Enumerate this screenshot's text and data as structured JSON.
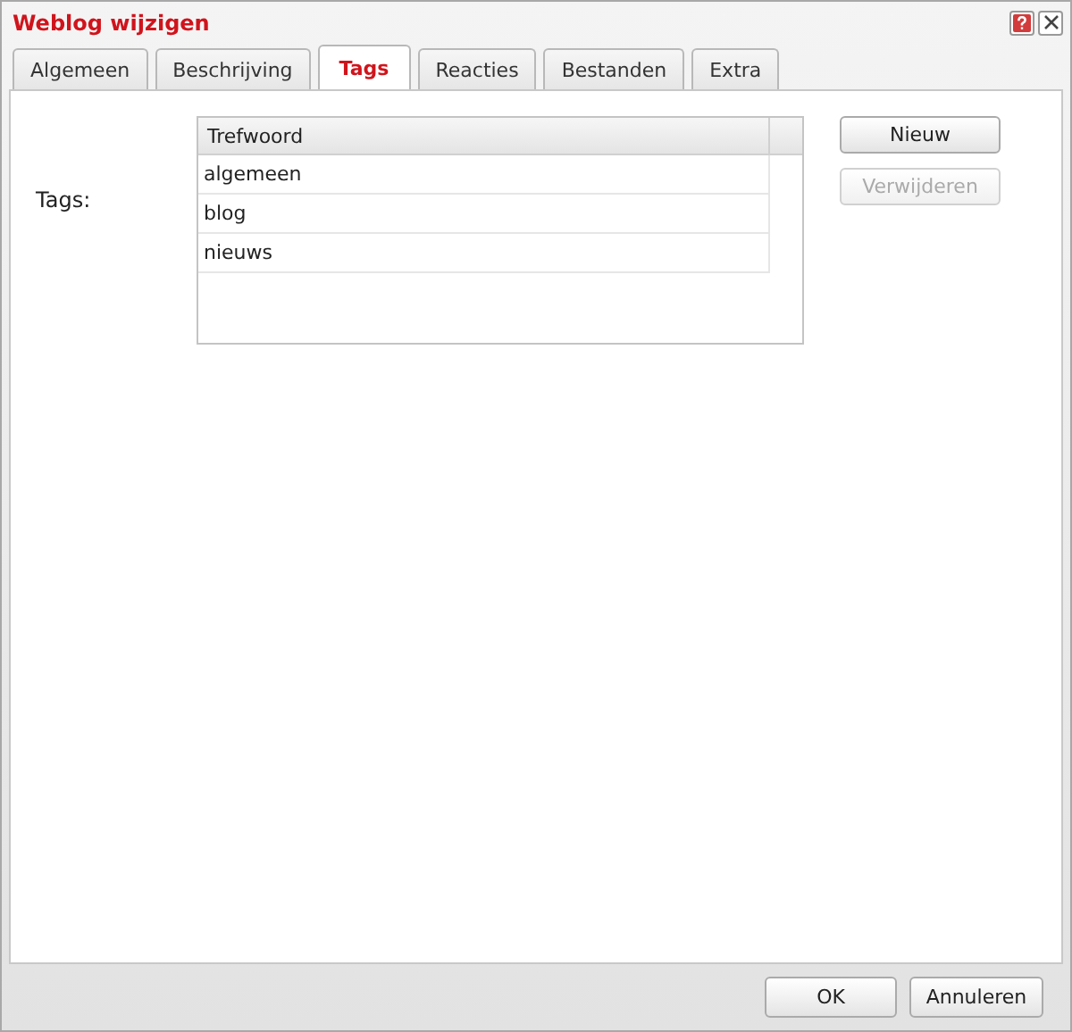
{
  "window": {
    "title": "Weblog wijzigen"
  },
  "tabs": [
    {
      "label": "Algemeen",
      "selected": false
    },
    {
      "label": "Beschrijving",
      "selected": false
    },
    {
      "label": "Tags",
      "selected": true
    },
    {
      "label": "Reacties",
      "selected": false
    },
    {
      "label": "Bestanden",
      "selected": false
    },
    {
      "label": "Extra",
      "selected": false
    }
  ],
  "field_label": "Tags:",
  "table": {
    "columns": [
      "Trefwoord"
    ],
    "rows": [
      [
        "algemeen"
      ],
      [
        "blog"
      ],
      [
        "nieuws"
      ]
    ]
  },
  "side_buttons": [
    {
      "label": "Nieuw",
      "disabled": false
    },
    {
      "label": "Verwijderen",
      "disabled": true
    }
  ],
  "footer_buttons": [
    "OK",
    "Annuleren"
  ]
}
